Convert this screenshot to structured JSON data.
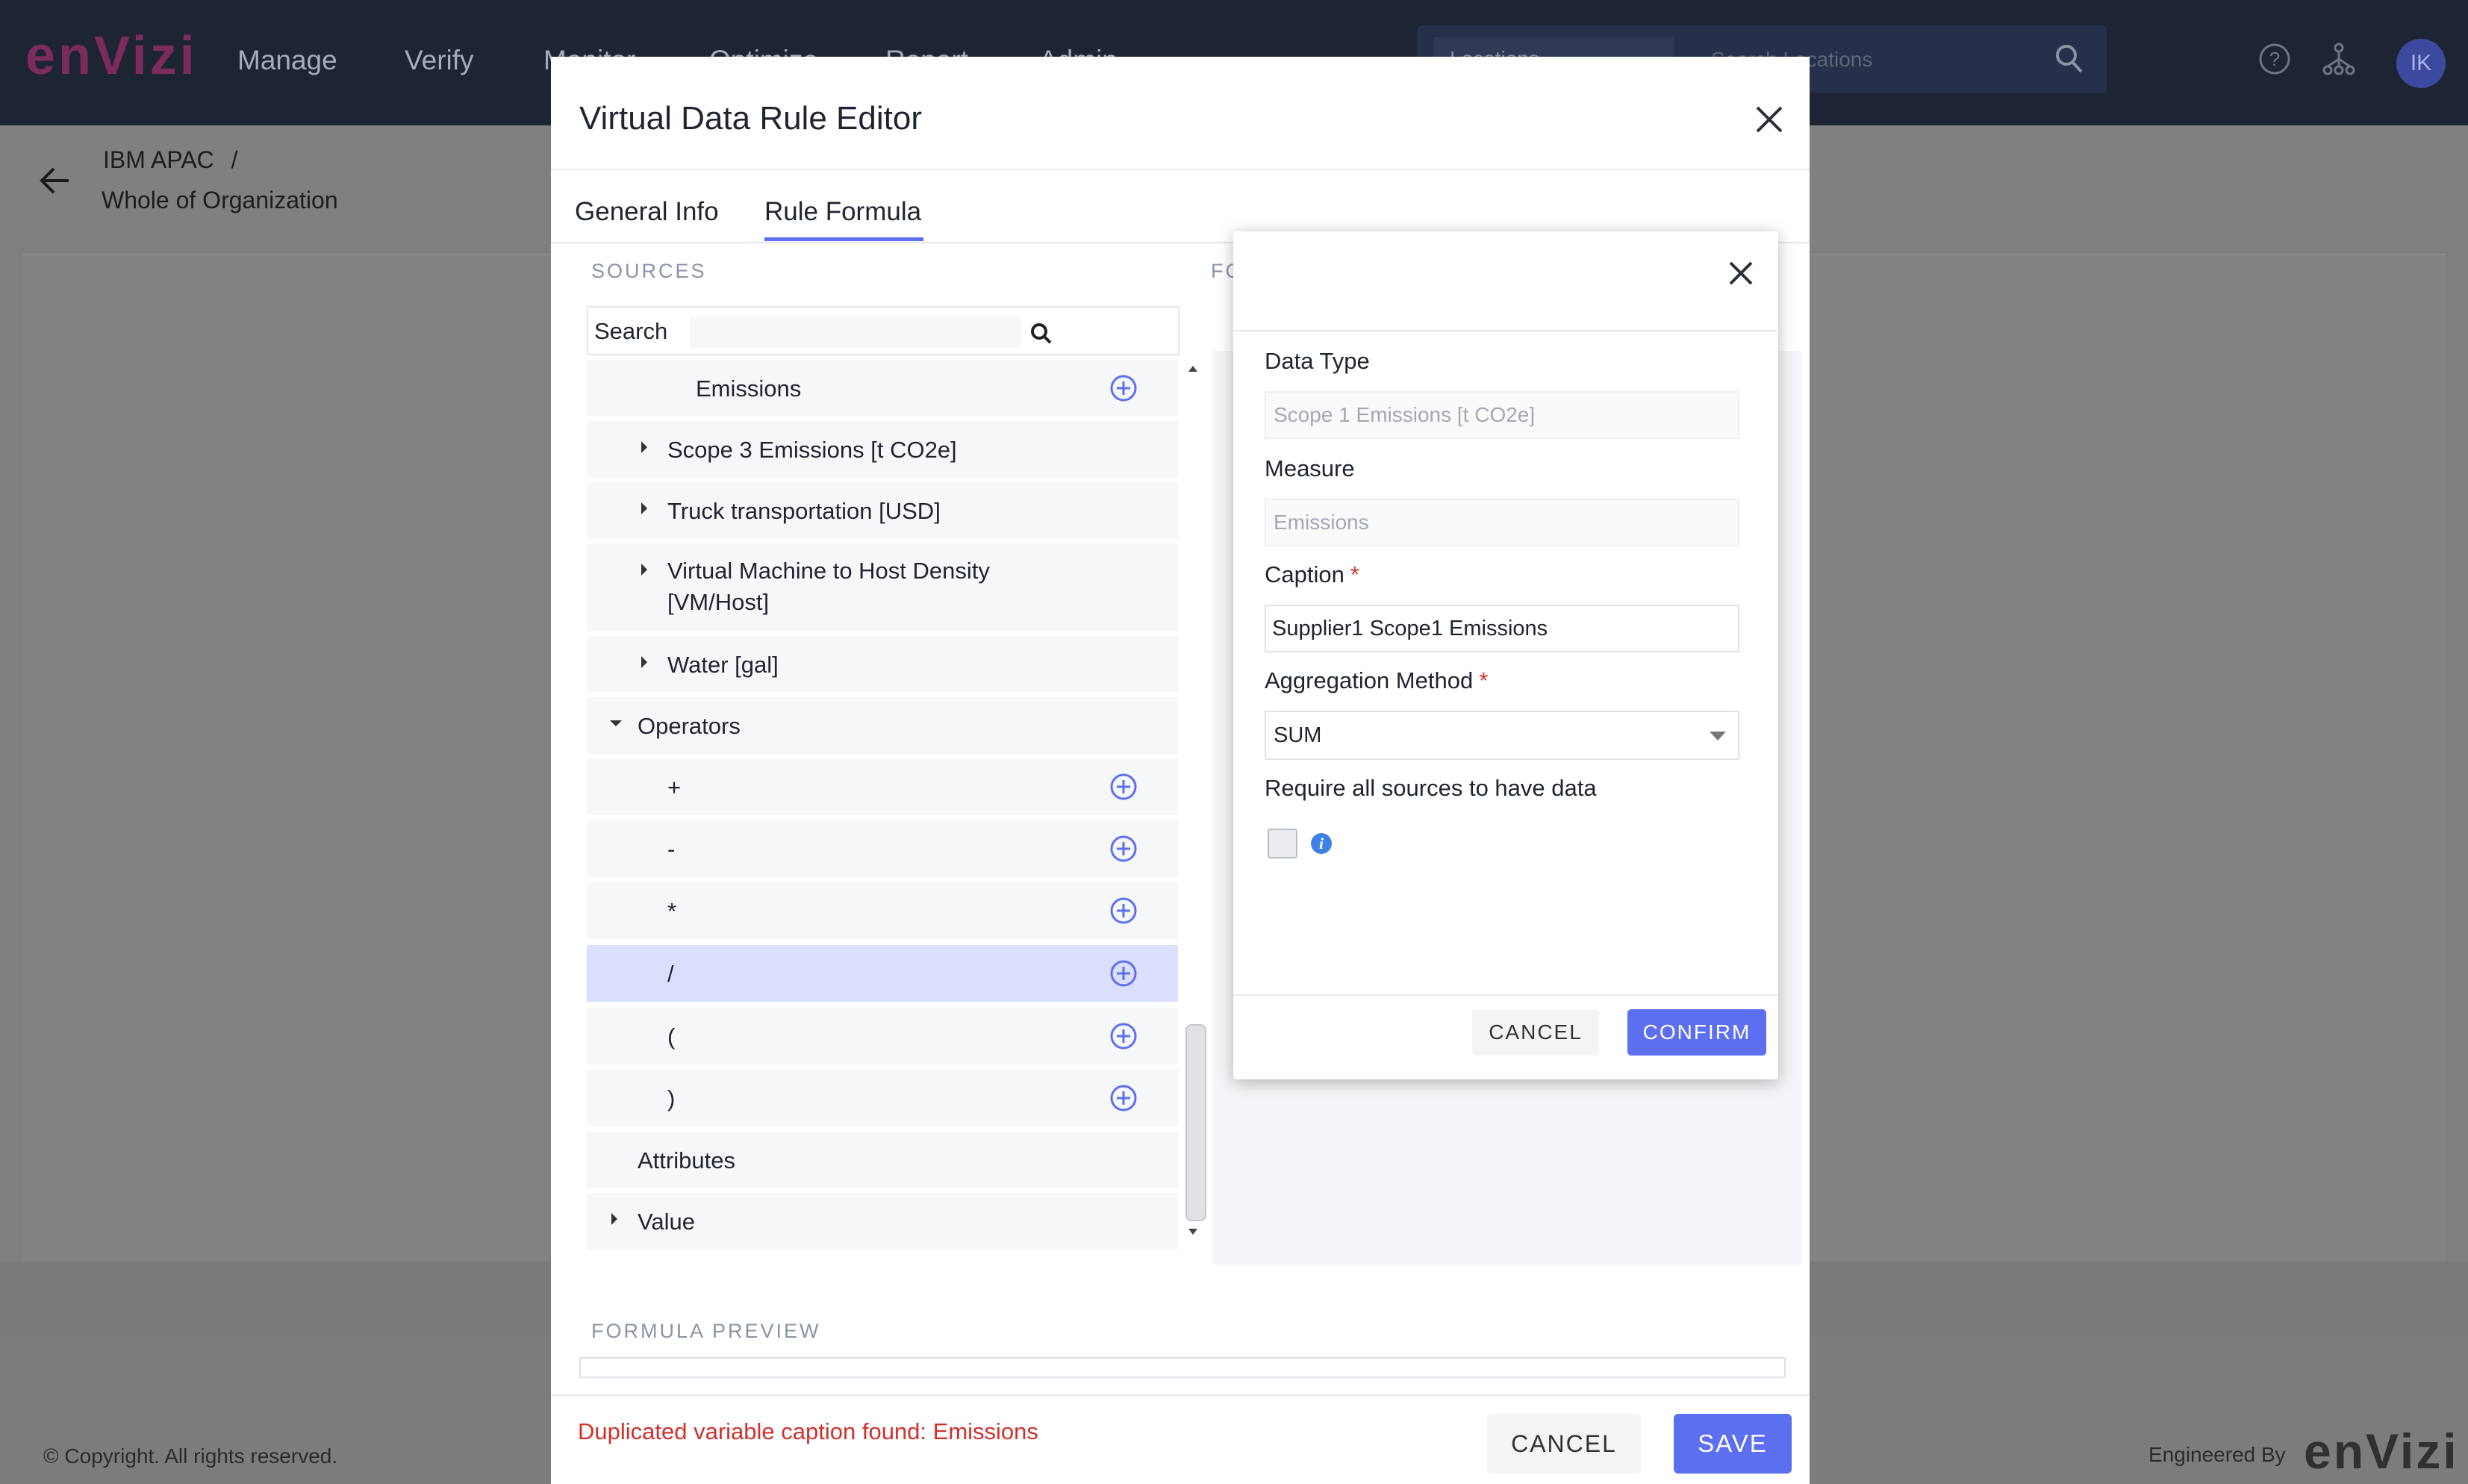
{
  "app": {
    "logo": "enVizi",
    "nav": [
      "Manage",
      "Verify",
      "Monitor",
      "Optimize",
      "Report",
      "Admin"
    ],
    "search_scope": "Locations",
    "search_placeholder": "Search Locations",
    "avatar_initials": "IK"
  },
  "breadcrumb": {
    "parent": "IBM APAC",
    "separator": "/",
    "current": "Whole of Organization"
  },
  "footer": {
    "copyright": "© Copyright. All rights reserved.",
    "engineered_by": "Engineered By",
    "logo": "enVizi"
  },
  "dialog": {
    "title": "Virtual Data Rule Editor",
    "tabs": [
      {
        "label": "General Info",
        "active": false
      },
      {
        "label": "Rule Formula",
        "active": true
      }
    ],
    "sources_label": "SOURCES",
    "formula_label": "FO",
    "search_label": "Search",
    "tree": [
      {
        "label": "Emissions",
        "kind": "leaf-add"
      },
      {
        "label": "Scope 3 Emissions [t CO2e]",
        "kind": "collapsed"
      },
      {
        "label": "Truck transportation [USD]",
        "kind": "collapsed"
      },
      {
        "label": "Virtual Machine to Host Density\n[VM/Host]",
        "kind": "collapsed"
      },
      {
        "label": "Water [gal]",
        "kind": "collapsed"
      },
      {
        "label": "Operators",
        "kind": "expanded"
      },
      {
        "label": "+",
        "kind": "leaf-add"
      },
      {
        "label": "-",
        "kind": "leaf-add"
      },
      {
        "label": "*",
        "kind": "leaf-add"
      },
      {
        "label": "/",
        "kind": "leaf-add",
        "selected": true
      },
      {
        "label": "(",
        "kind": "leaf-add"
      },
      {
        "label": ")",
        "kind": "leaf-add"
      },
      {
        "label": "Attributes",
        "kind": "group"
      },
      {
        "label": "Value",
        "kind": "collapsed"
      }
    ],
    "formula_preview_label": "FORMULA PREVIEW",
    "error": "Duplicated variable caption found: Emissions",
    "cancel": "CANCEL",
    "save": "SAVE"
  },
  "popup": {
    "data_type_label": "Data Type",
    "data_type_value": "Scope 1 Emissions [t CO2e]",
    "measure_label": "Measure",
    "measure_value": "Emissions",
    "caption_label": "Caption",
    "caption_value": "Supplier1 Scope1 Emissions",
    "aggregation_label": "Aggregation Method",
    "aggregation_value": "SUM",
    "require_label": "Require all sources to have data",
    "require_checked": false,
    "info_glyph": "i",
    "required_mark": "*",
    "cancel": "CANCEL",
    "confirm": "CONFIRM"
  },
  "colors": {
    "accent": "#5c6ff0",
    "error": "#d0312d",
    "topbar": "#1d2535"
  }
}
